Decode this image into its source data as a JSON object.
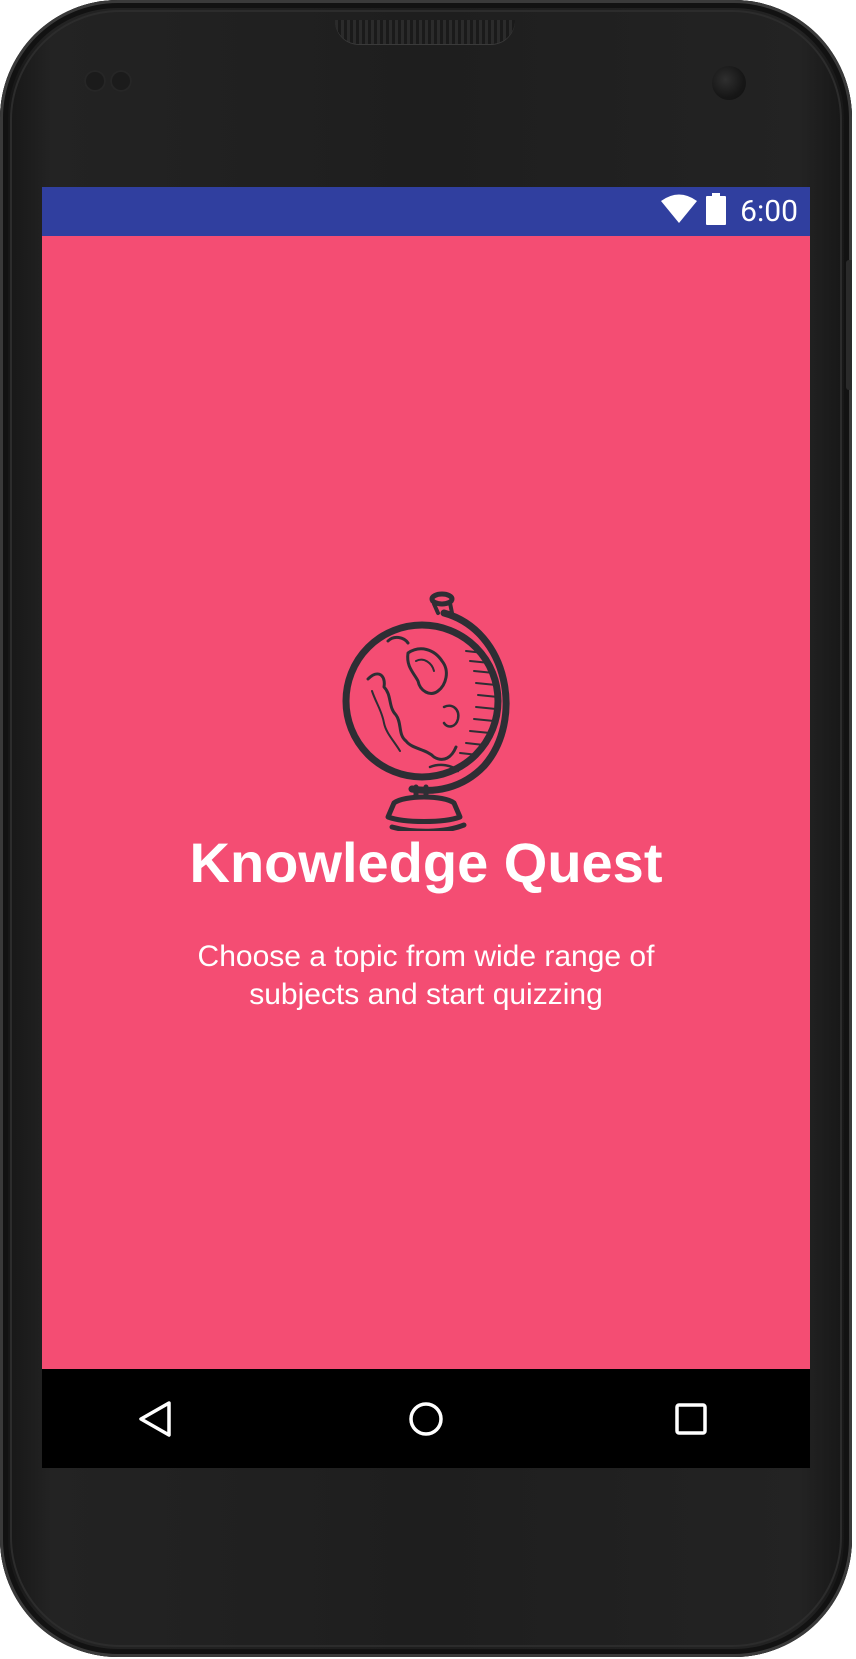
{
  "colors": {
    "status_bar": "#303f9f",
    "app_background": "#f44d73",
    "nav_bar": "#000000",
    "text": "#ffffff",
    "illustration": "#2e2e34"
  },
  "status_bar": {
    "time": "6:00",
    "icons": [
      "wifi-icon",
      "battery-icon"
    ]
  },
  "app": {
    "illustration": "globe-icon",
    "title": "Knowledge Quest",
    "subtitle": "Choose a topic from wide range of subjects and start quizzing"
  },
  "nav_bar": {
    "buttons": [
      "back-icon",
      "home-icon",
      "recents-icon"
    ]
  }
}
